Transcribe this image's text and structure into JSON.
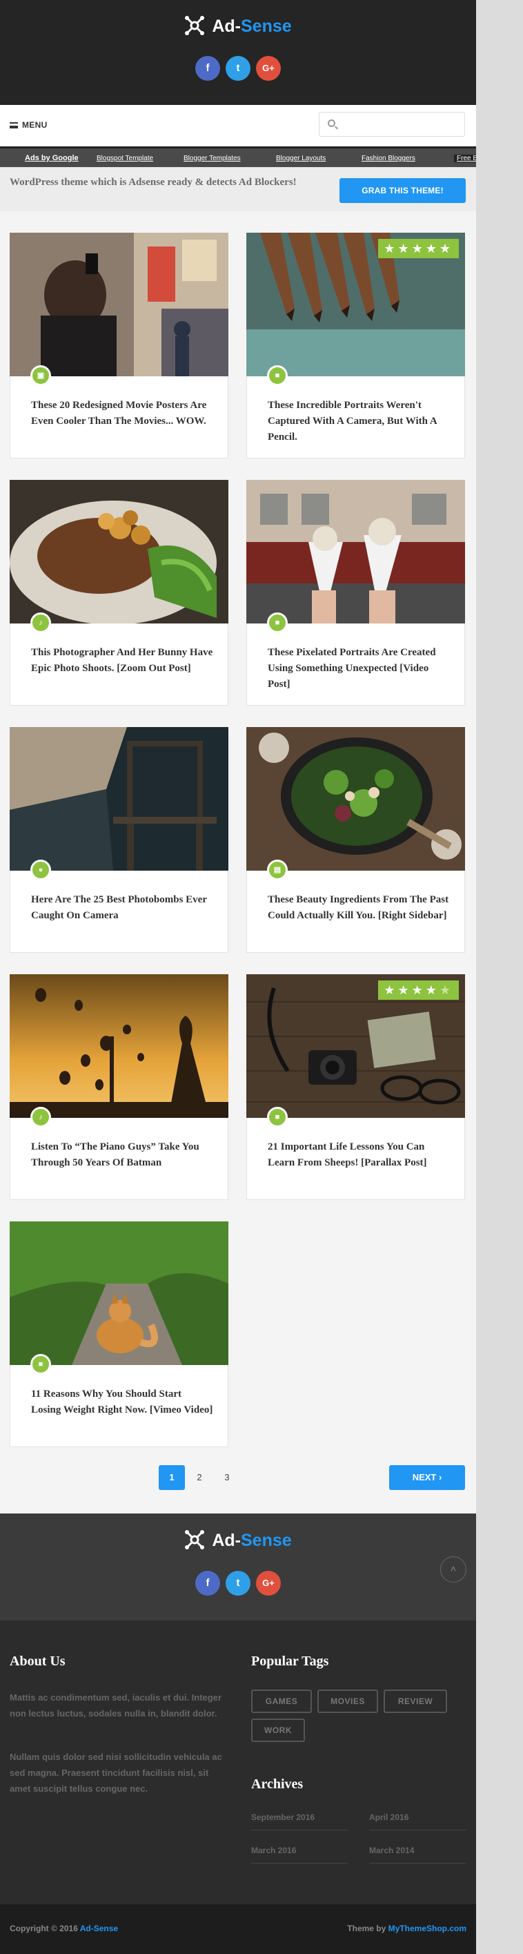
{
  "site": {
    "brand_part1": "Ad-",
    "brand_part2": "Sense"
  },
  "socials": {
    "facebook": "f",
    "twitter": "t",
    "google": "G+"
  },
  "nav": {
    "menu_label": "MENU",
    "search_placeholder": ""
  },
  "ads_bar": {
    "ads_by": "Ads by Google",
    "links": [
      "Blogspot Template",
      "Blogger Templates",
      "Blogger Layouts",
      "Fashion Bloggers",
      "Free Blogspot"
    ]
  },
  "promo": {
    "text": "WordPress theme which is Adsense ready & detects Ad Blockers!",
    "button": "GRAB THIS THEME!"
  },
  "posts": [
    {
      "title": "These 20 Redesigned Movie Posters Are Even Cooler Than The Movies... WOW.",
      "format_icon": "image-icon",
      "rating": 0
    },
    {
      "title": "These Incredible Portraits Weren't Captured With A Camera, But With A Pencil.",
      "format_icon": "video-icon",
      "rating": 5
    },
    {
      "title": "This Photographer And Her Bunny Have Epic Photo Shoots. [Zoom Out Post]",
      "format_icon": "music-icon",
      "rating": 0
    },
    {
      "title": "These Pixelated Portraits Are Created Using Something Unexpected [Video Post]",
      "format_icon": "video-icon",
      "rating": 0
    },
    {
      "title": "Here Are The 25 Best Photobombs Ever Caught On Camera",
      "format_icon": "pin-icon",
      "rating": 0
    },
    {
      "title": "These Beauty Ingredients From The Past Could Actually Kill You. [Right Sidebar]",
      "format_icon": "gallery-icon",
      "rating": 0
    },
    {
      "title": "Listen To “The Piano Guys” Take You Through 50 Years Of Batman",
      "format_icon": "music-icon",
      "rating": 0
    },
    {
      "title": "21 Important Life Lessons You Can Learn From Sheeps! [Parallax Post]",
      "format_icon": "video-icon",
      "rating": 4
    },
    {
      "title": "11 Reasons Why You Should Start Losing Weight Right Now. [Vimeo Video]",
      "format_icon": "video-icon",
      "rating": 0
    }
  ],
  "pagination": {
    "pages": [
      "1",
      "2",
      "3"
    ],
    "current": "1",
    "next": "NEXT ›"
  },
  "footer": {
    "about_heading": "About Us",
    "about_p1": "Mattis ac condimentum sed, iaculis et dui. Integer non lectus luctus, sodales nulla in, blandit dolor.",
    "about_p2": "Nullam quis dolor sed nisi sollicitudin vehicula ac sed magna. Praesent tincidunt facilisis nisl, sit amet suscipit tellus congue nec.",
    "tags_heading": "Popular Tags",
    "tags": [
      "GAMES",
      "MOVIES",
      "REVIEW",
      "WORK"
    ],
    "archives_heading": "Archives",
    "archives": [
      "September 2016",
      "April 2016",
      "March 2016",
      "March 2014"
    ],
    "copyright_prefix": "Copyright © 2016",
    "copyright_site": "Ad-Sense",
    "theme_prefix": "Theme by",
    "theme_link": "MyThemeShop.com",
    "to_top": "˄"
  },
  "colors": {
    "accent": "#2196f3",
    "format_badge": "#8dc33f",
    "header_bg": "#252525",
    "footer_bg": "#2c2c2c"
  }
}
